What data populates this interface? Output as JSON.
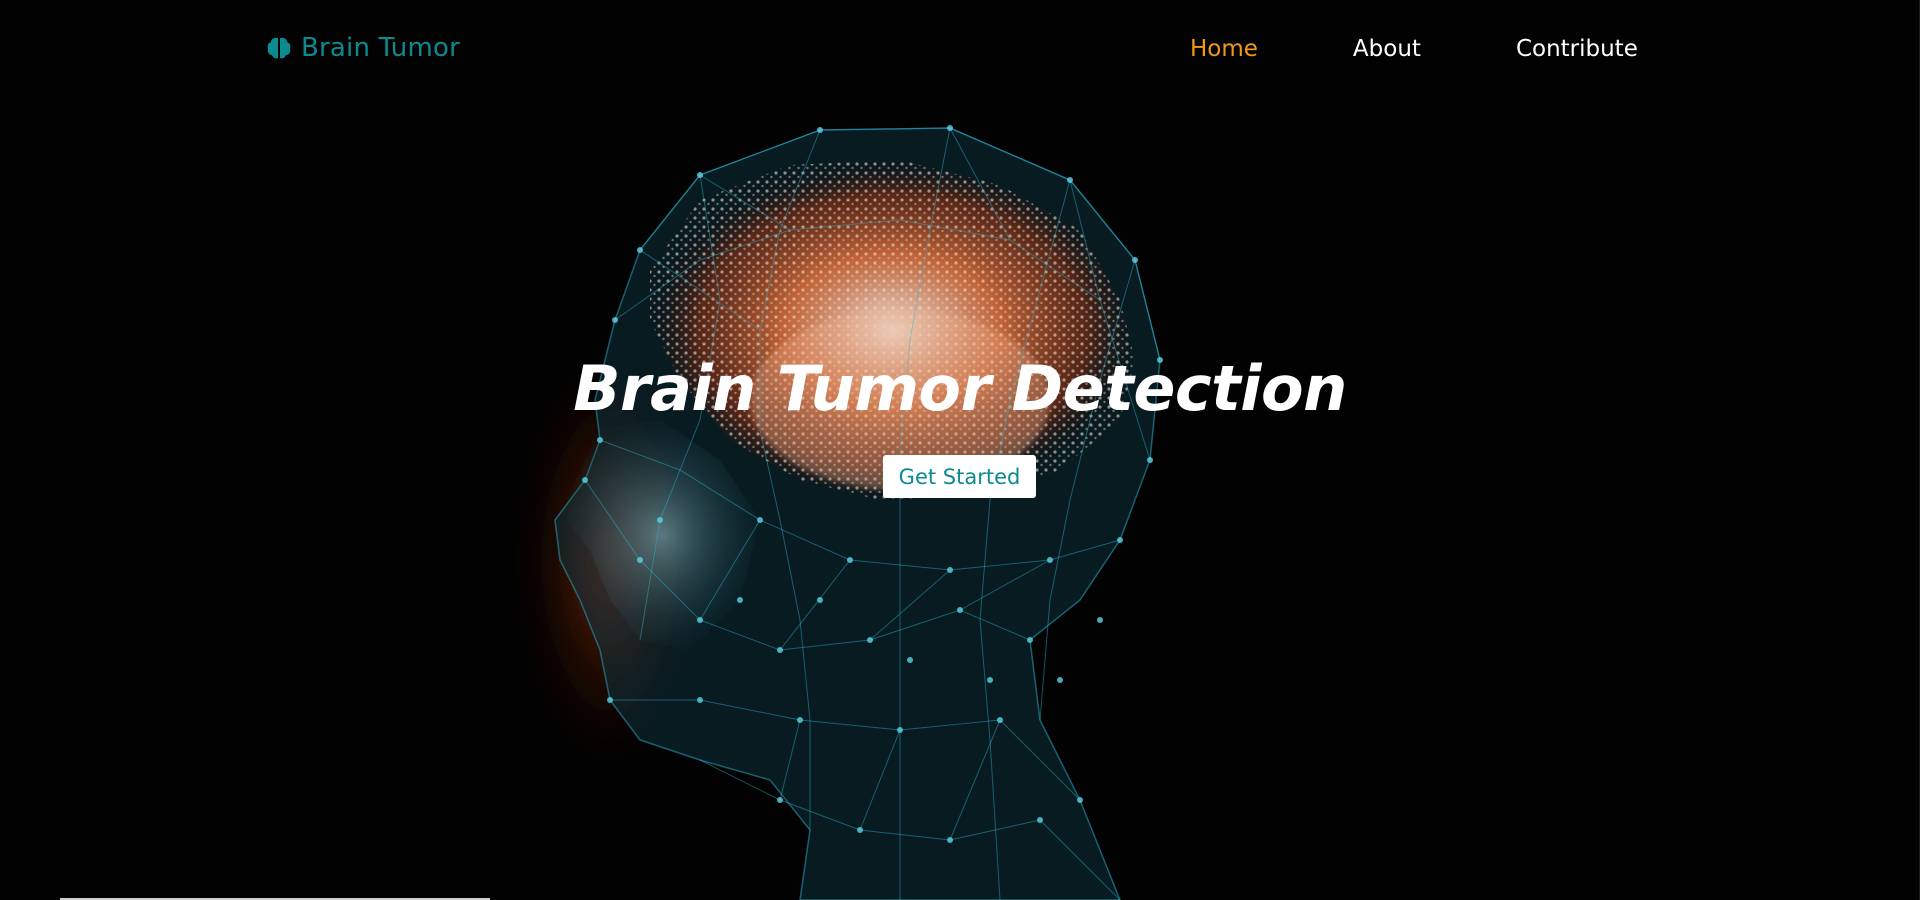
{
  "navbar": {
    "brand_text": "Brain Tumor",
    "brand_icon": "brain-icon",
    "links": [
      {
        "label": "Home",
        "active": true
      },
      {
        "label": "About",
        "active": false
      },
      {
        "label": "Contribute",
        "active": false
      }
    ]
  },
  "hero": {
    "title": "Brain Tumor Detection",
    "cta_label": "Get Started"
  },
  "colors": {
    "brand_teal": "#0b8b8f",
    "active_link": "#f2961c",
    "text_white": "#ffffff",
    "background": "#000000",
    "mesh_cyan": "#1fa6c0",
    "brain_glow": "#d2552a"
  }
}
